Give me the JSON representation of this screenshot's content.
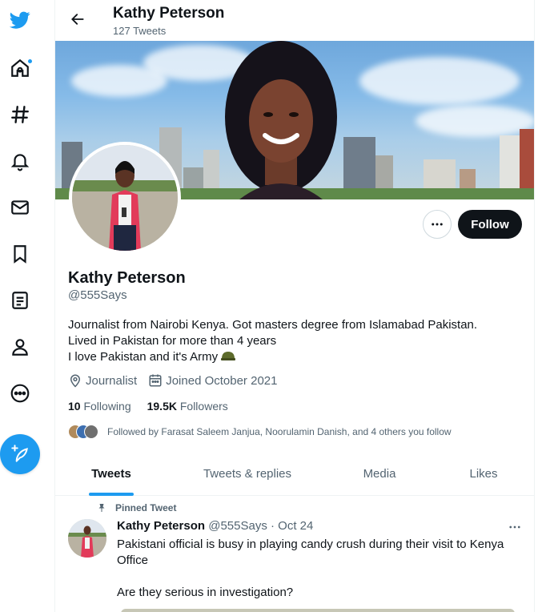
{
  "header": {
    "name": "Kathy Peterson",
    "tweet_count": "127 Tweets"
  },
  "nav": {
    "icons": [
      "twitter-logo-icon",
      "home-icon",
      "explore-hashtag-icon",
      "notifications-bell-icon",
      "messages-envelope-icon",
      "bookmarks-icon",
      "lists-icon",
      "profile-icon",
      "more-icon",
      "compose-tweet-icon"
    ],
    "accent_color": "#1d9bf0"
  },
  "profile": {
    "name": "Kathy Peterson",
    "handle": "@555Says",
    "bio_line1": "Journalist from Nairobi Kenya. Got masters degree from Islamabad Pakistan.",
    "bio_line2": "Lived in Pakistan for more than 4 years",
    "bio_line3": "I love Pakistan and it's Army",
    "location": "Journalist",
    "joined": "Joined October 2021",
    "following_count": "10",
    "following_label": "Following",
    "followers_count": "19.5K",
    "followers_label": "Followers",
    "followed_by": "Followed by Farasat Saleem Janjua, Noorulamin Danish, and 4 others you follow",
    "follow_label": "Follow"
  },
  "tabs": [
    {
      "label": "Tweets",
      "active": true
    },
    {
      "label": "Tweets & replies",
      "active": false
    },
    {
      "label": "Media",
      "active": false
    },
    {
      "label": "Likes",
      "active": false
    }
  ],
  "pinned_tweet": {
    "pinned_label": "Pinned Tweet",
    "author_name": "Kathy Peterson",
    "author_handle": "@555Says",
    "separator": "·",
    "date": "Oct 24",
    "text": "Pakistani official is busy in playing candy crush during their visit to Kenya Office",
    "text2": "Are they serious in investigation?"
  }
}
